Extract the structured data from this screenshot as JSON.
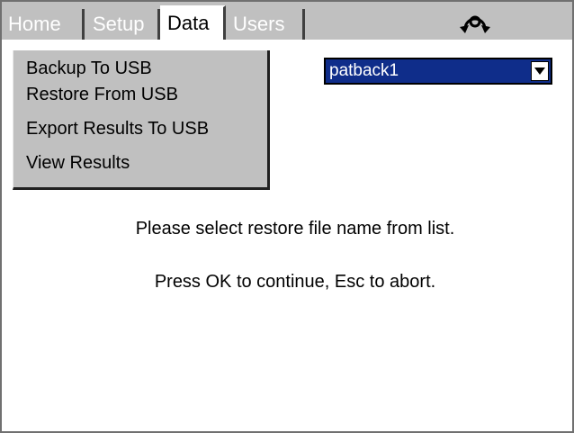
{
  "tabs": [
    {
      "label": "Home",
      "active": false
    },
    {
      "label": "Setup",
      "active": false
    },
    {
      "label": "Data",
      "active": true
    },
    {
      "label": "Users",
      "active": false
    }
  ],
  "menu": {
    "items": [
      {
        "label": "Backup To USB"
      },
      {
        "label": "Restore From USB"
      },
      {
        "label": "Export Results To USB"
      },
      {
        "label": "View Results"
      }
    ]
  },
  "file_select": {
    "value": "patback1"
  },
  "messages": {
    "line1": "Please select restore file name from list.",
    "line2": "Press OK to continue, Esc to abort."
  },
  "icons": {
    "rotate": "rotate-orientation-icon",
    "dropdown": "dropdown-arrow-icon"
  },
  "colors": {
    "tab_bar": "#c0c0c0",
    "select_background": "#0f2d8a",
    "menu_background": "#c0c0c0"
  }
}
